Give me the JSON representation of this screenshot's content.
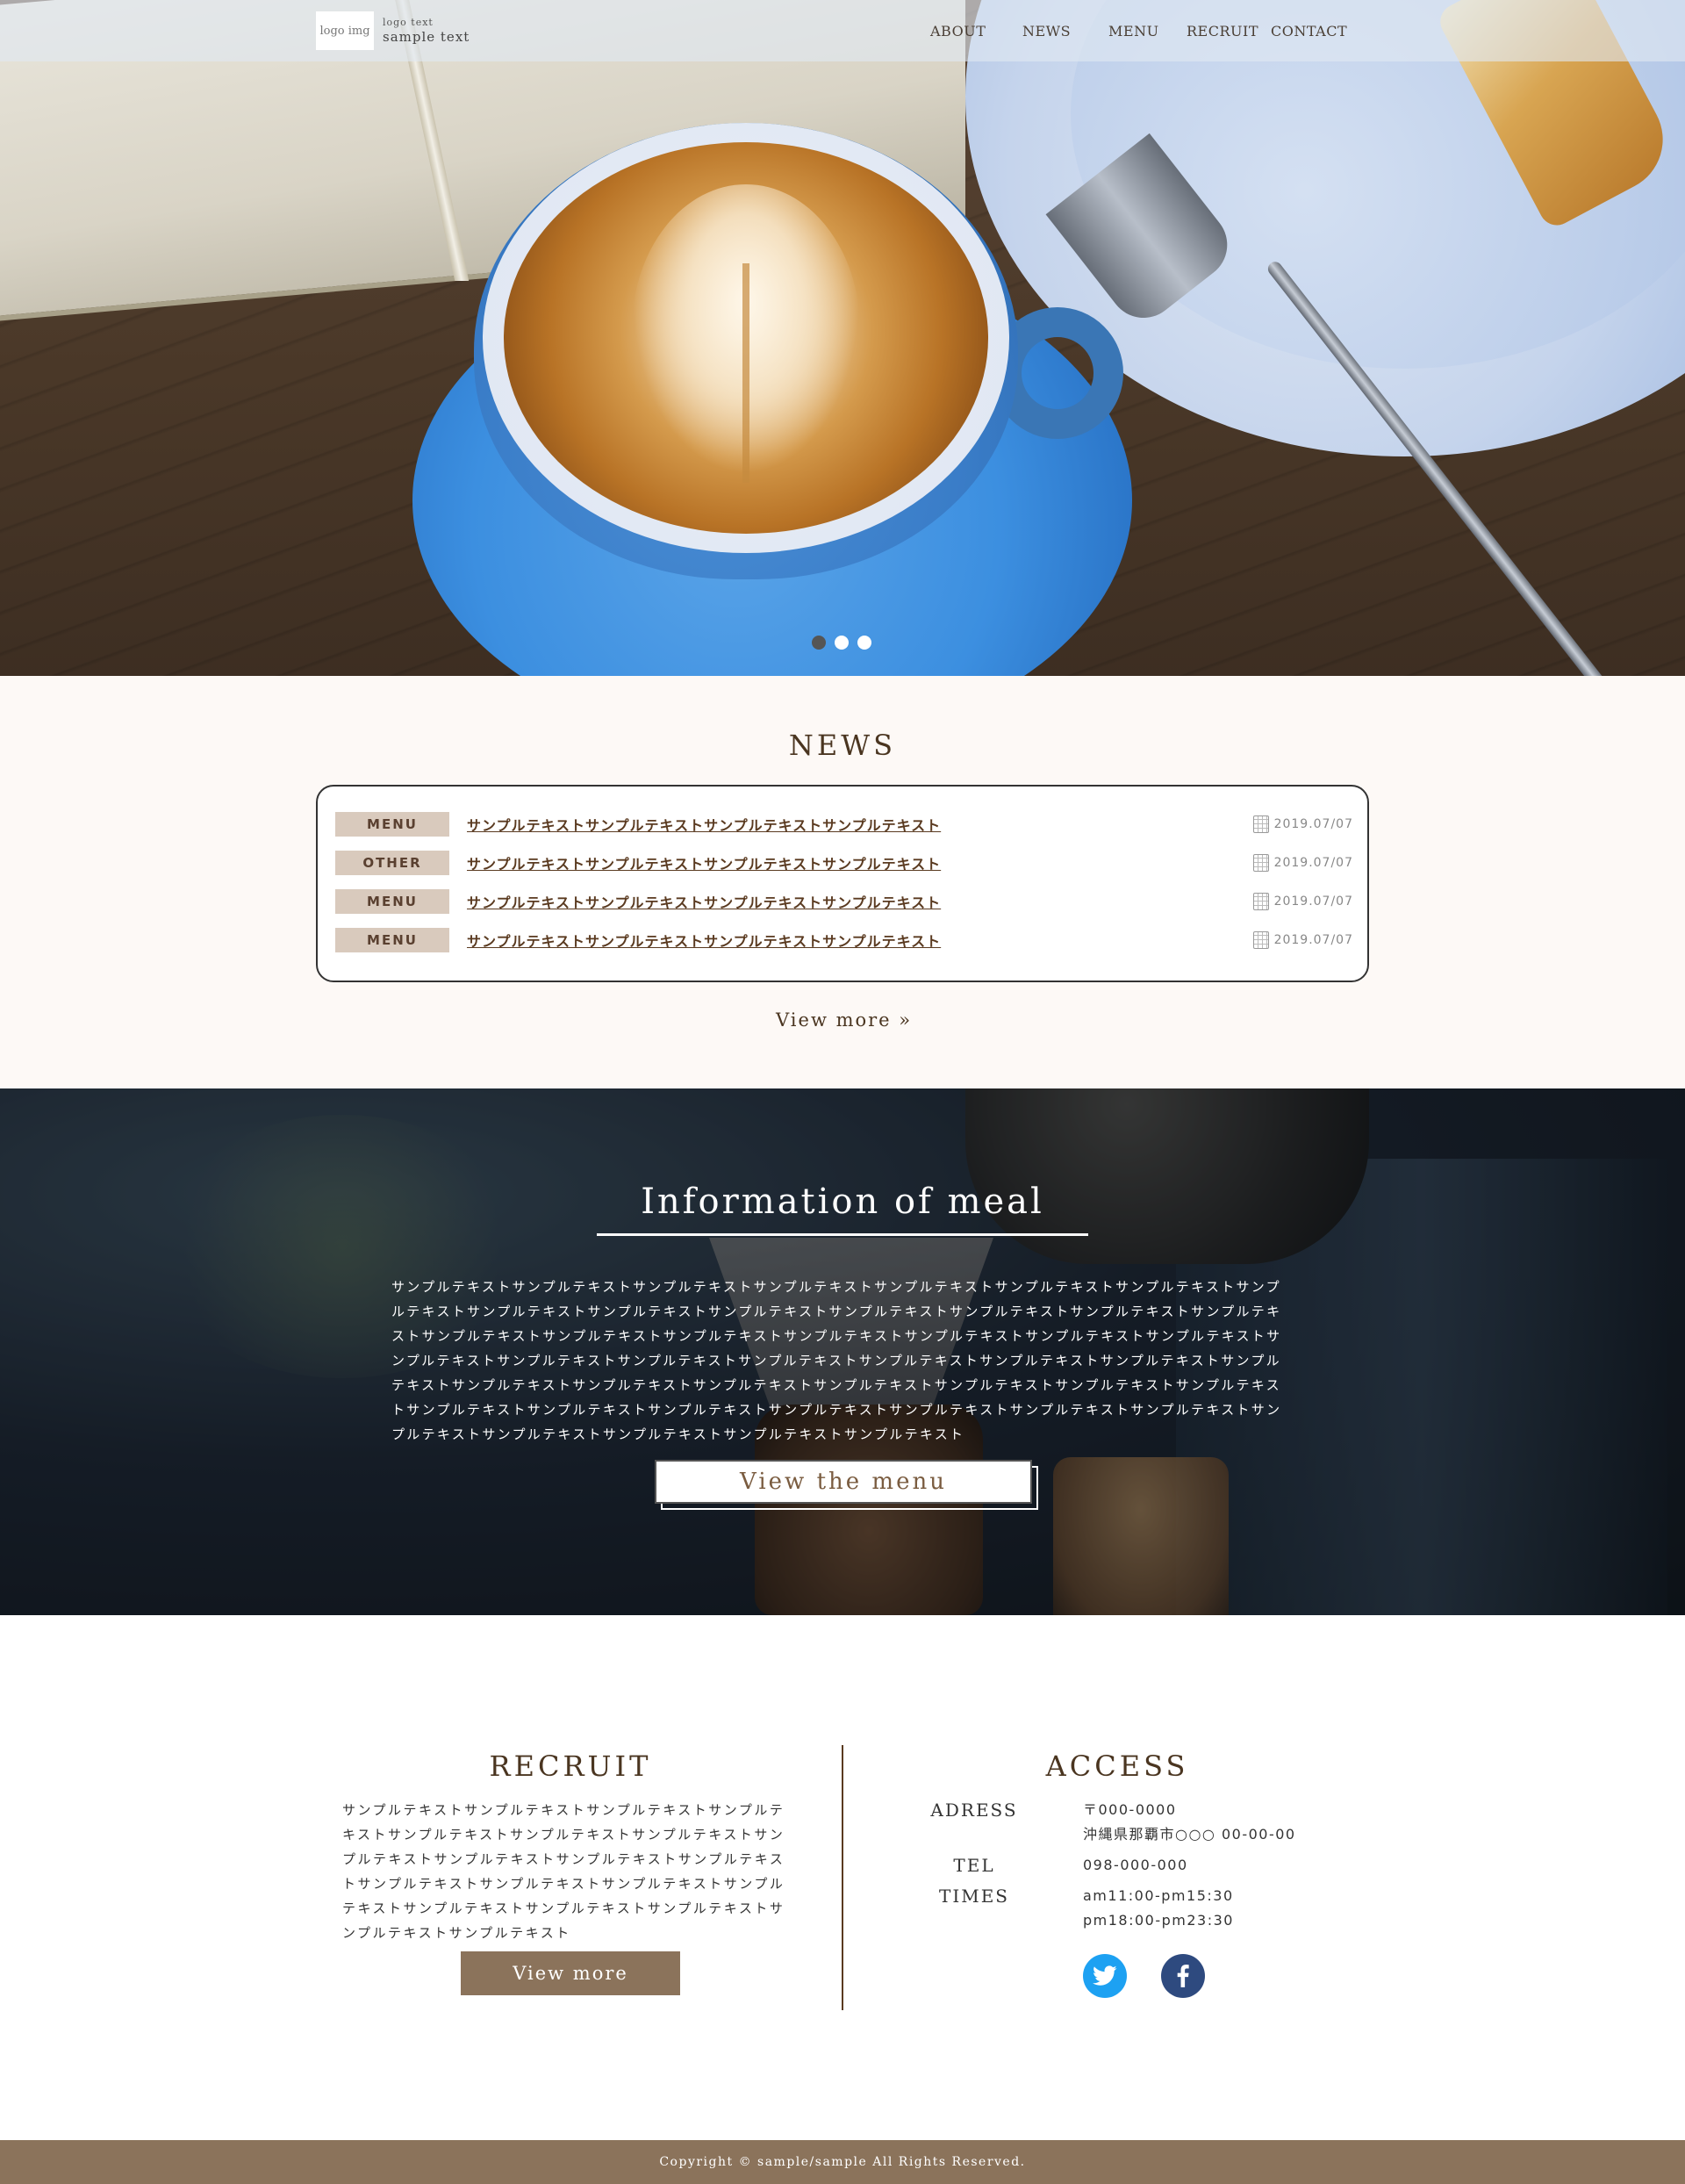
{
  "header": {
    "logo_img": "logo img",
    "logo_text_small": "logo text",
    "logo_text": "sample text",
    "nav": [
      "ABOUT",
      "NEWS",
      "MENU",
      "RECRUIT",
      "CONTACT"
    ]
  },
  "hero": {
    "slides_total": 3,
    "active_slide": 1
  },
  "news": {
    "title": "NEWS",
    "items": [
      {
        "category": "MENU",
        "text": "サンプルテキストサンプルテキストサンプルテキストサンプルテキスト",
        "date": "2019.07/07"
      },
      {
        "category": "OTHER",
        "text": "サンプルテキストサンプルテキストサンプルテキストサンプルテキスト",
        "date": "2019.07/07"
      },
      {
        "category": "MENU",
        "text": "サンプルテキストサンプルテキストサンプルテキストサンプルテキスト",
        "date": "2019.07/07"
      },
      {
        "category": "MENU",
        "text": "サンプルテキストサンプルテキストサンプルテキストサンプルテキスト",
        "date": "2019.07/07"
      }
    ],
    "view_more": "View more »"
  },
  "meal": {
    "title": "Information of meal",
    "text": "サンプルテキストサンプルテキストサンプルテキストサンプルテキストサンプルテキストサンプルテキストサンプルテキストサンプルテキストサンプルテキストサンプルテキストサンプルテキストサンプルテキストサンプルテキストサンプルテキストサンプルテキストサンプルテキストサンプルテキストサンプルテキストサンプルテキストサンプルテキストサンプルテキストサンプルテキストサンプルテキストサンプルテキストサンプルテキストサンプルテキストサンプルテキストサンプルテキストサンプルテキストサンプルテキストサンプルテキストサンプルテキストサンプルテキストサンプルテキストサンプルテキストサンプルテキストサンプルテキストサンプルテキストサンプルテキストサンプルテキストサンプルテキストサンプルテキストサンプルテキストサンプルテキストサンプルテキストサンプルテキストサンプルテキストサンプルテキストサンプルテキスト",
    "button": "View the menu"
  },
  "recruit": {
    "title": "RECRUIT",
    "text": "サンプルテキストサンプルテキストサンプルテキストサンプルテキストサンプルテキストサンプルテキストサンプルテキストサンプルテキストサンプルテキストサンプルテキストサンプルテキストサンプルテキストサンプルテキストサンプルテキストサンプルテキストサンプルテキストサンプルテキストサンプルテキストサンプルテキストサンプルテキスト",
    "button": "View more"
  },
  "access": {
    "title": "ACCESS",
    "adress_label": "ADRESS",
    "postal": "〒000-0000",
    "address": "沖縄県那覇市○○○ 00-00-00",
    "tel_label": "TEL",
    "tel": "098-000-000",
    "times_label": "TIMES",
    "times_1": "am11:00-pm15:30",
    "times_2": "pm18:00-pm23:30",
    "social": [
      "twitter-icon",
      "facebook-icon"
    ]
  },
  "footer": {
    "copyright": "Copyright ©   sample/sample All Rights Reserved."
  },
  "colors": {
    "accent_brown": "#8b735b",
    "title_brown": "#4a3520",
    "news_bg": "#fdf9f6",
    "category_bg": "#d9cabd",
    "twitter": "#1da1f2",
    "facebook": "#2e4a7f"
  }
}
